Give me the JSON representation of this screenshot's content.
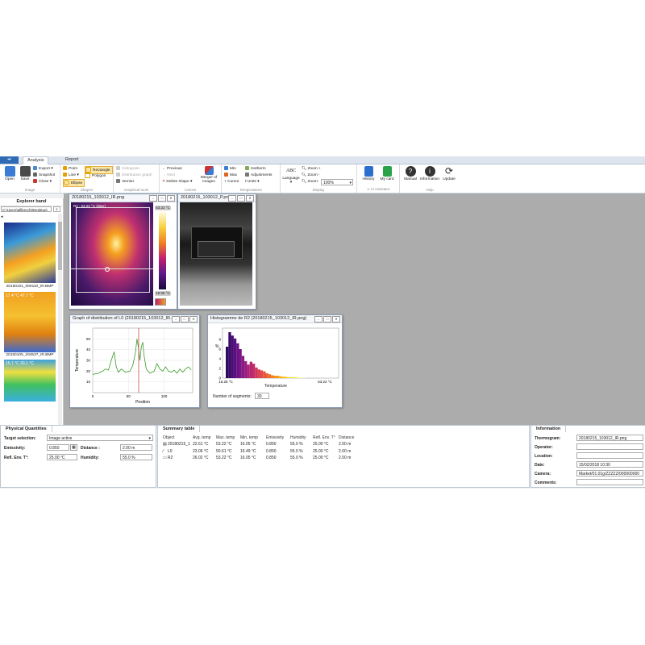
{
  "tabs": [
    "Analysis",
    "Report"
  ],
  "ribbon": {
    "image_group": {
      "label": "Image",
      "open": "Open",
      "save": "Save",
      "export": "Export",
      "snapshot": "Snapshot",
      "close": "Close"
    },
    "shapes_group": {
      "label": "Shapes",
      "point": "Point",
      "line": "Line",
      "ellipse": "Ellipse",
      "rectangle": "Rectangle",
      "polygon": "Polygon"
    },
    "graphical_group": {
      "label": "Graphical tools",
      "histogram": "Histogram",
      "distribution": "Distribution graph",
      "vernier": "Vernier"
    },
    "actions_group": {
      "label": "Actions",
      "previous": "Previous",
      "next": "Next",
      "delete_shape": "Delete shape",
      "merger": "Merger of images"
    },
    "temperatures_group": {
      "label": "Temperatures",
      "min": "Min",
      "max": "Max",
      "cursor": "Cursor",
      "isotherm": "Isotherm",
      "adjustments": "Adjustments",
      "units": "Units"
    },
    "display_group": {
      "label": "Display",
      "language": "Language",
      "zoom_in": "Zoom +",
      "zoom_out": "Zoom -",
      "zoom": "Zoom:",
      "zoom_value": "100%"
    },
    "ai_group": {
      "label": "AI Assistant",
      "history": "History",
      "mycard": "My card"
    },
    "help_group": {
      "label": "Help",
      "manual": "Manual",
      "information": "Information",
      "update": "Update"
    }
  },
  "explorer": {
    "title": "Explorer band",
    "path": "C:\\Users\\alllbrecht\\Desktop\\",
    "thumbs": [
      "20150101_000110_IR.BMP",
      "20150105_204537_IR.BMP"
    ],
    "thumb_overlay": [
      "17.4 °C  47.7 °C",
      "15.7 °C  30.1 °C"
    ]
  },
  "windows": {
    "ir_title": "20180215_103012_IR.png",
    "ir_label": "R2 : 53.22 °C (Max)",
    "scale_max": "53.22 °C",
    "scale_min": "16.05 °C",
    "vis_title": "20180215_103012_P.png",
    "dist_title": "Graph of distribution of L0 (20180215_103012_IR.p...",
    "hist_title": "Histogramme de R2 (20180215_103012_IR.png)",
    "segments_label": "Number of segments:",
    "segments_value": "30"
  },
  "dist_chart": {
    "ylabel": "Temperature",
    "xlabel": "Position",
    "yticks": [
      "50",
      "40",
      "30",
      "20",
      "10"
    ],
    "xticks": [
      "0",
      "50",
      "100"
    ]
  },
  "hist_chart": {
    "ylabel": "%",
    "xlabel": "Temperature",
    "yticks": [
      "8",
      "6",
      "4",
      "2",
      "0"
    ],
    "xmin": "16.25 °C",
    "xmax": "53.22 °C"
  },
  "physical": {
    "title": "Physical Quantities",
    "target_label": "Target selection:",
    "target_value": "Image active",
    "emissivity_label": "Emissivity:",
    "emissivity_value": "0.850",
    "distance_label": "Distance :",
    "distance_value": "2.00 m",
    "refl_label": "Refl. Env. T°:",
    "refl_value": "25.00 °C",
    "humidity_label": "Humidity:",
    "humidity_value": "55.0 %"
  },
  "summary": {
    "title": "Summary table",
    "headers": [
      "Object",
      "Avg. temp",
      "Max. temp",
      "Min. temp",
      "Emissivity",
      "Humidity",
      "Refl. Env. T°",
      "Distance"
    ],
    "rows": [
      [
        "20180215_1",
        "22.61 °C",
        "53.22 °C",
        "16.05 °C",
        "0.850",
        "55.0 %",
        "25.00 °C",
        "2.00 m"
      ],
      [
        "L0",
        "23.06 °C",
        "50.61 °C",
        "16.49 °C",
        "0.850",
        "55.0 %",
        "25.00 °C",
        "2.00 m"
      ],
      [
        "R2",
        "26.02 °C",
        "53.22 °C",
        "16.05 °C",
        "0.850",
        "55.0 %",
        "25.00 °C",
        "2.00 m"
      ]
    ]
  },
  "info": {
    "title": "Information",
    "thermogram_label": "Thermogram:",
    "thermogram_value": "20180215_103012_IR.png",
    "operator_label": "Operator:",
    "location_label": "Location:",
    "date_label": "Date:",
    "date_value": "15/02/2018 10:30",
    "camera_label": "Camera:",
    "camera_value": "Market/01.01g/ZZZZZ/000000000",
    "comments_label": "Comments:"
  }
}
